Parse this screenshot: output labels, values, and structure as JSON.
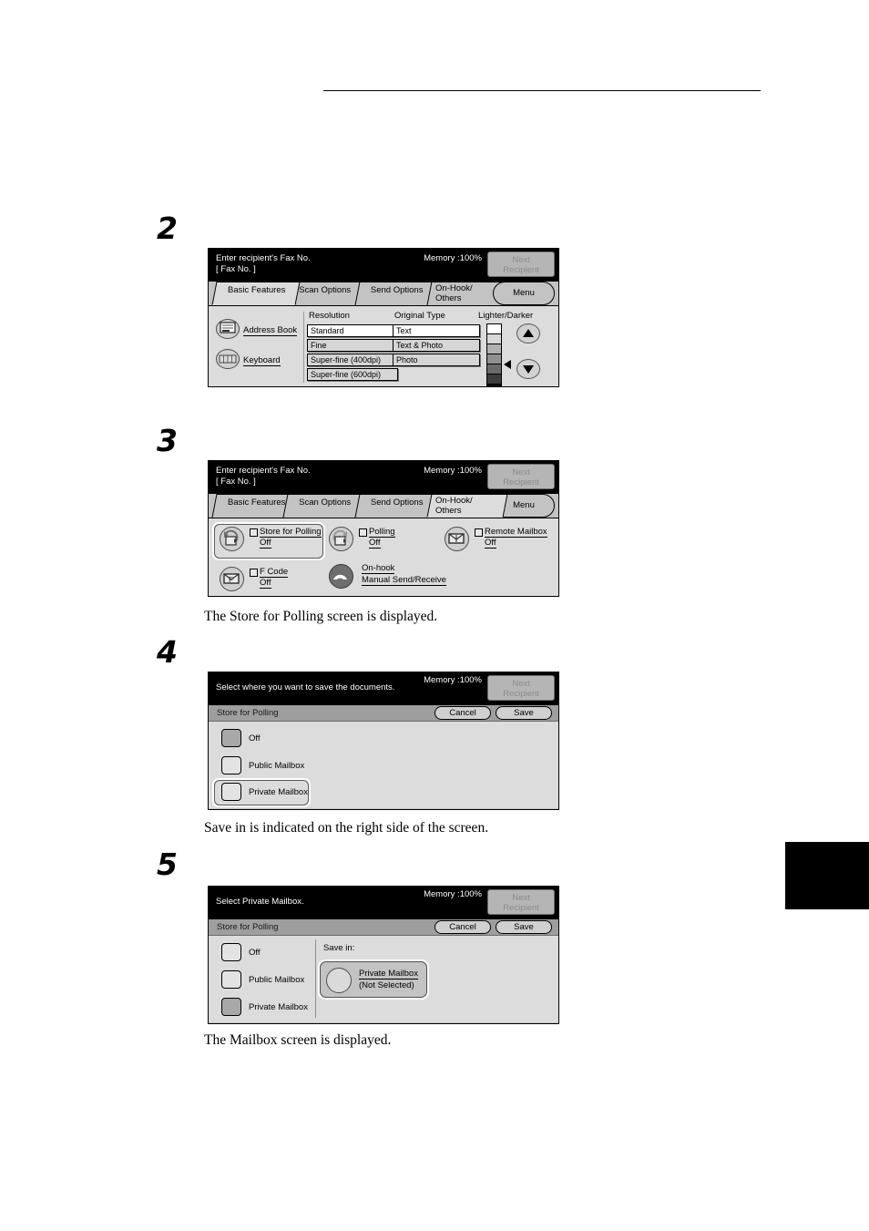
{
  "page": {
    "thumb_tab": "",
    "header_rule": true
  },
  "steps": [
    {
      "number": "2"
    },
    {
      "number": "3"
    },
    {
      "number": "4"
    },
    {
      "number": "5"
    }
  ],
  "captions": [
    {
      "text": "The Store for Polling screen is displayed."
    },
    {
      "text": "Save in is indicated on the right side of the screen."
    },
    {
      "text": "The Mailbox screen is displayed."
    }
  ],
  "screen1": {
    "title_message": "Enter recipient's Fax No.\n[  Fax No. ]",
    "memory": "Memory :100%",
    "next_recipient": "Next\nRecipient",
    "tabs": [
      {
        "label": "Basic Features",
        "active": true
      },
      {
        "label": "Scan Options",
        "active": false
      },
      {
        "label": "Send Options",
        "active": false
      },
      {
        "label": "On-Hook/\nOthers",
        "active": false
      },
      {
        "label": "Menu",
        "active": false
      }
    ],
    "side_buttons": [
      {
        "label": "Address Book",
        "icon": "address-book-icon"
      },
      {
        "label": "Keyboard",
        "icon": "keyboard-icon"
      }
    ],
    "resolution": {
      "heading": "Resolution",
      "options": [
        {
          "label": "Standard",
          "selected": true
        },
        {
          "label": "Fine",
          "selected": false
        },
        {
          "label": "Super-fine (400dpi)",
          "selected": false
        },
        {
          "label": "Super-fine (600dpi)",
          "selected": false
        }
      ]
    },
    "original_type": {
      "heading": "Original Type",
      "options": [
        {
          "label": "Text",
          "selected": true
        },
        {
          "label": "Text & Photo",
          "selected": false
        },
        {
          "label": "Photo",
          "selected": false
        }
      ]
    },
    "lighter_darker": {
      "heading": "Lighter/Darker",
      "levels": 7,
      "current_index": 4,
      "swatches": [
        "#ffffff",
        "#d8d8d8",
        "#b0b0b0",
        "#8f8f8f",
        "#6a6a6a",
        "#3d3d3d",
        "#0d0d0d"
      ],
      "up_icon": "arrow-up-icon",
      "down_icon": "arrow-down-icon"
    }
  },
  "screen2": {
    "title_message": "Enter recipient's Fax No.\n[  Fax No. ]",
    "memory": "Memory :100%",
    "next_recipient": "Next\nRecipient",
    "tabs": [
      {
        "label": "Basic Features",
        "active": false
      },
      {
        "label": "Scan Options",
        "active": false
      },
      {
        "label": "Send Options",
        "active": false
      },
      {
        "label": "On-Hook/\nOthers",
        "active": true
      },
      {
        "label": "Menu",
        "active": false
      }
    ],
    "features": [
      {
        "title": "Store for Polling",
        "value": "Off",
        "icon": "store-for-polling-icon",
        "selected": true,
        "checkbox": true
      },
      {
        "title": "Polling",
        "value": "Off",
        "icon": "polling-icon",
        "selected": false,
        "checkbox": true
      },
      {
        "title": "Remote Mailbox",
        "value": "Off",
        "icon": "remote-mailbox-icon",
        "selected": false,
        "checkbox": true
      },
      {
        "title": "F Code",
        "value": "Off",
        "icon": "f-code-icon",
        "selected": false,
        "checkbox": true
      },
      {
        "title": "On-hook",
        "value": "Manual Send/Receive",
        "icon": "on-hook-handset-icon",
        "selected": false,
        "checkbox": false
      }
    ]
  },
  "screen3": {
    "title_message": "Select where you want to save the documents.",
    "memory": "Memory :100%",
    "next_recipient": "Next\nRecipient",
    "subbar_label": "Store for Polling",
    "cancel_label": "Cancel",
    "save_label": "Save",
    "items": [
      {
        "label": "Off",
        "state": "on"
      },
      {
        "label": "Public Mailbox",
        "state": "off"
      },
      {
        "label": "Private Mailbox",
        "state": "off",
        "highlighted": true
      }
    ]
  },
  "screen4": {
    "title_message": "Select Private Mailbox.",
    "memory": "Memory :100%",
    "next_recipient": "Next\nRecipient",
    "subbar_label": "Store for Polling",
    "cancel_label": "Cancel",
    "save_label": "Save",
    "items": [
      {
        "label": "Off",
        "state": "off"
      },
      {
        "label": "Public Mailbox",
        "state": "off"
      },
      {
        "label": "Private Mailbox",
        "state": "on"
      }
    ],
    "save_in_label": "Save in:",
    "mailbox_card": {
      "title": "Private Mailbox",
      "subtitle": "(Not Selected)",
      "icon": "mailbox-circle-icon"
    }
  }
}
